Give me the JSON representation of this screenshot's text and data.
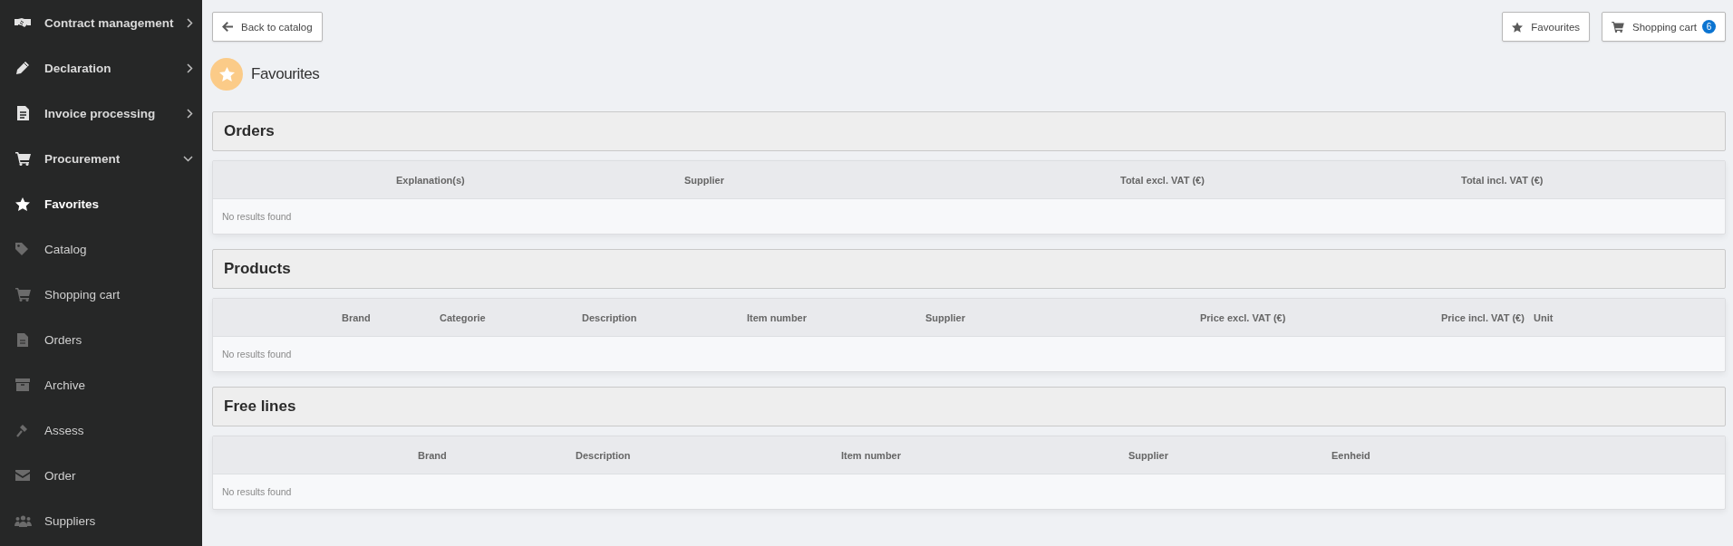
{
  "sidebar": {
    "items": [
      {
        "label": "Contract management",
        "expanded": false,
        "selected": false
      },
      {
        "label": "Declaration",
        "expanded": false,
        "selected": false
      },
      {
        "label": "Invoice processing",
        "expanded": false,
        "selected": false
      },
      {
        "label": "Procurement",
        "expanded": true,
        "selected": false,
        "children": [
          {
            "label": "Favorites",
            "selected": true
          },
          {
            "label": "Catalog",
            "selected": false
          },
          {
            "label": "Shopping cart",
            "selected": false
          },
          {
            "label": "Orders",
            "selected": false
          },
          {
            "label": "Archive",
            "selected": false
          },
          {
            "label": "Assess",
            "selected": false
          },
          {
            "label": "Order",
            "selected": false
          },
          {
            "label": "Suppliers",
            "selected": false
          }
        ]
      }
    ]
  },
  "toolbar": {
    "back_button": "Back to catalog",
    "favourites_button": "Favourites",
    "cart_button": {
      "label": "Shopping cart",
      "count": "6"
    }
  },
  "page_title": "Favourites",
  "sections": [
    {
      "title": "Orders",
      "columns": [
        "Explanation(s)",
        "Supplier",
        "Total excl. VAT (€)",
        "Total incl. VAT (€)"
      ],
      "empty_text": "No results found"
    },
    {
      "title": "Products",
      "columns": [
        "Brand",
        "Categorie",
        "Description",
        "Item number",
        "Supplier",
        "Price excl. VAT (€)",
        "Price incl. VAT (€)",
        "Unit"
      ],
      "empty_text": "No results found"
    },
    {
      "title": "Free lines",
      "columns": [
        "Brand",
        "Description",
        "Item number",
        "Supplier",
        "Eenheid"
      ],
      "empty_text": "No results found"
    }
  ]
}
